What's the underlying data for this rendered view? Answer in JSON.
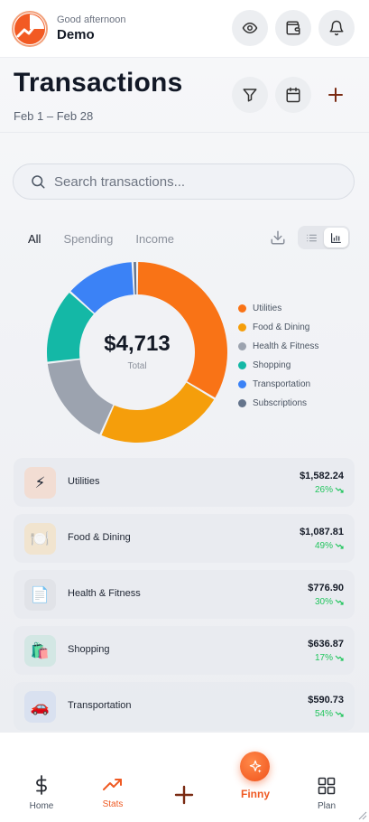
{
  "header": {
    "greeting": "Good afternoon",
    "user_name": "Demo"
  },
  "page": {
    "title": "Transactions",
    "date_range": "Feb 1 – Feb 28"
  },
  "search": {
    "placeholder": "Search transactions..."
  },
  "tabs": [
    {
      "label": "All",
      "active": true
    },
    {
      "label": "Spending",
      "active": false
    },
    {
      "label": "Income",
      "active": false
    }
  ],
  "view_mode": "chart",
  "chart_data": {
    "type": "pie",
    "donut": true,
    "center_value": "$4,713",
    "center_label": "Total",
    "legend_position": "right",
    "slices": [
      {
        "label": "Utilities",
        "value": 1582.24,
        "color": "#f97316"
      },
      {
        "label": "Food & Dining",
        "value": 1087.81,
        "color": "#f59e0b"
      },
      {
        "label": "Health & Fitness",
        "value": 776.9,
        "color": "#9ca3af"
      },
      {
        "label": "Shopping",
        "value": 636.87,
        "color": "#14b8a6"
      },
      {
        "label": "Transportation",
        "value": 590.73,
        "color": "#3b82f6"
      },
      {
        "label": "Subscriptions",
        "value": 38.45,
        "color": "#64748b"
      }
    ]
  },
  "categories": [
    {
      "name": "Utilities",
      "amount": "$1,582.24",
      "change": "26%",
      "icon": "⚡",
      "icon_bg": "#f2ddd3"
    },
    {
      "name": "Food & Dining",
      "amount": "$1,087.81",
      "change": "49%",
      "icon": "🍽️",
      "icon_bg": "#f1e4cf"
    },
    {
      "name": "Health & Fitness",
      "amount": "$776.90",
      "change": "30%",
      "icon": "📄",
      "icon_bg": "#e1e3e8"
    },
    {
      "name": "Shopping",
      "amount": "$636.87",
      "change": "17%",
      "icon": "🛍️",
      "icon_bg": "#d3e7e4"
    },
    {
      "name": "Transportation",
      "amount": "$590.73",
      "change": "54%",
      "icon": "🚗",
      "icon_bg": "#d9e1f0"
    }
  ],
  "bottom_nav": {
    "home": "Home",
    "stats": "Stats",
    "finny": "Finny",
    "plan": "Plan",
    "active": "stats"
  },
  "colors": {
    "accent": "#ef5a23",
    "positive": "#22c55e",
    "icon_dark": "#7a2a12"
  }
}
